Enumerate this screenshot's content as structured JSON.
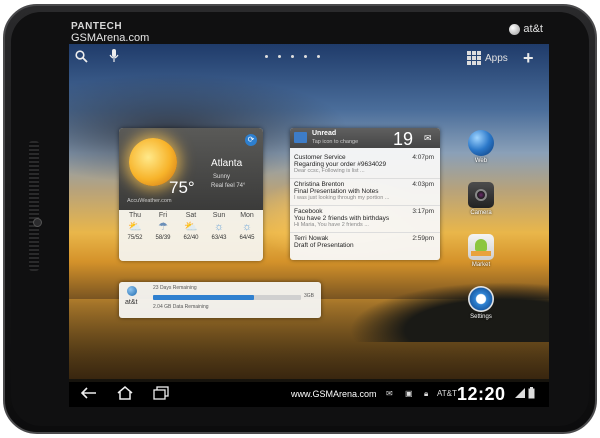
{
  "device": {
    "brand": "PANTECH",
    "watermark": "GSMArena.com",
    "carrier_logo": "at&t"
  },
  "top_bar": {
    "search_icon": "search-icon",
    "voice_icon": "microphone-icon",
    "apps_label": "Apps",
    "add_icon": "plus-icon"
  },
  "weather": {
    "city": "Atlanta",
    "condition": "Sunny",
    "real_feel": "Real feel 74°",
    "temperature": "75°",
    "source": "AccuWeather.com",
    "forecast": [
      {
        "day": "Thu",
        "temps": "75/52",
        "icon": "partly-cloudy-icon"
      },
      {
        "day": "Fri",
        "temps": "58/39",
        "icon": "rain-icon"
      },
      {
        "day": "Sat",
        "temps": "62/40",
        "icon": "partly-cloudy-icon"
      },
      {
        "day": "Sun",
        "temps": "63/43",
        "icon": "sun-icon"
      },
      {
        "day": "Mon",
        "temps": "64/45",
        "icon": "sun-icon"
      }
    ]
  },
  "att_widget": {
    "logo_text": "at&t",
    "days_remaining": "23 Days Remaining",
    "data_remaining": "2.04 GB Data Remaining",
    "plan_size": "3GB",
    "usage_fraction": 0.68
  },
  "email": {
    "header_title": "Unread",
    "header_sub": "Tap icon to change",
    "unread_count": "19",
    "messages": [
      {
        "from": "Customer Service",
        "subject": "Regarding your order #9634029",
        "preview": "Dear ccsc, Following is list ...",
        "time": "4:07pm"
      },
      {
        "from": "Christina Brenton",
        "subject": "Final Presentation with Notes",
        "preview": "I was just looking through my portion ...",
        "time": "4:03pm"
      },
      {
        "from": "Facebook",
        "subject": "You have 2 friends with birthdays",
        "preview": "Hi Maria, You have 2 friends ...",
        "time": "3:17pm"
      },
      {
        "from": "Terri Nowak",
        "subject": "Draft of Presentation",
        "preview": "",
        "time": "2:59pm"
      }
    ]
  },
  "shortcuts": [
    {
      "label": "Web",
      "icon": "globe-icon"
    },
    {
      "label": "Camera",
      "icon": "camera-icon"
    },
    {
      "label": "Market",
      "icon": "market-icon"
    },
    {
      "label": "Settings",
      "icon": "settings-icon"
    }
  ],
  "nav_bar": {
    "url": "www.GSMArena.com",
    "carrier": "AT&T",
    "time": "12:20",
    "back_icon": "back-icon",
    "home_icon": "home-icon",
    "recent_icon": "recent-apps-icon"
  }
}
